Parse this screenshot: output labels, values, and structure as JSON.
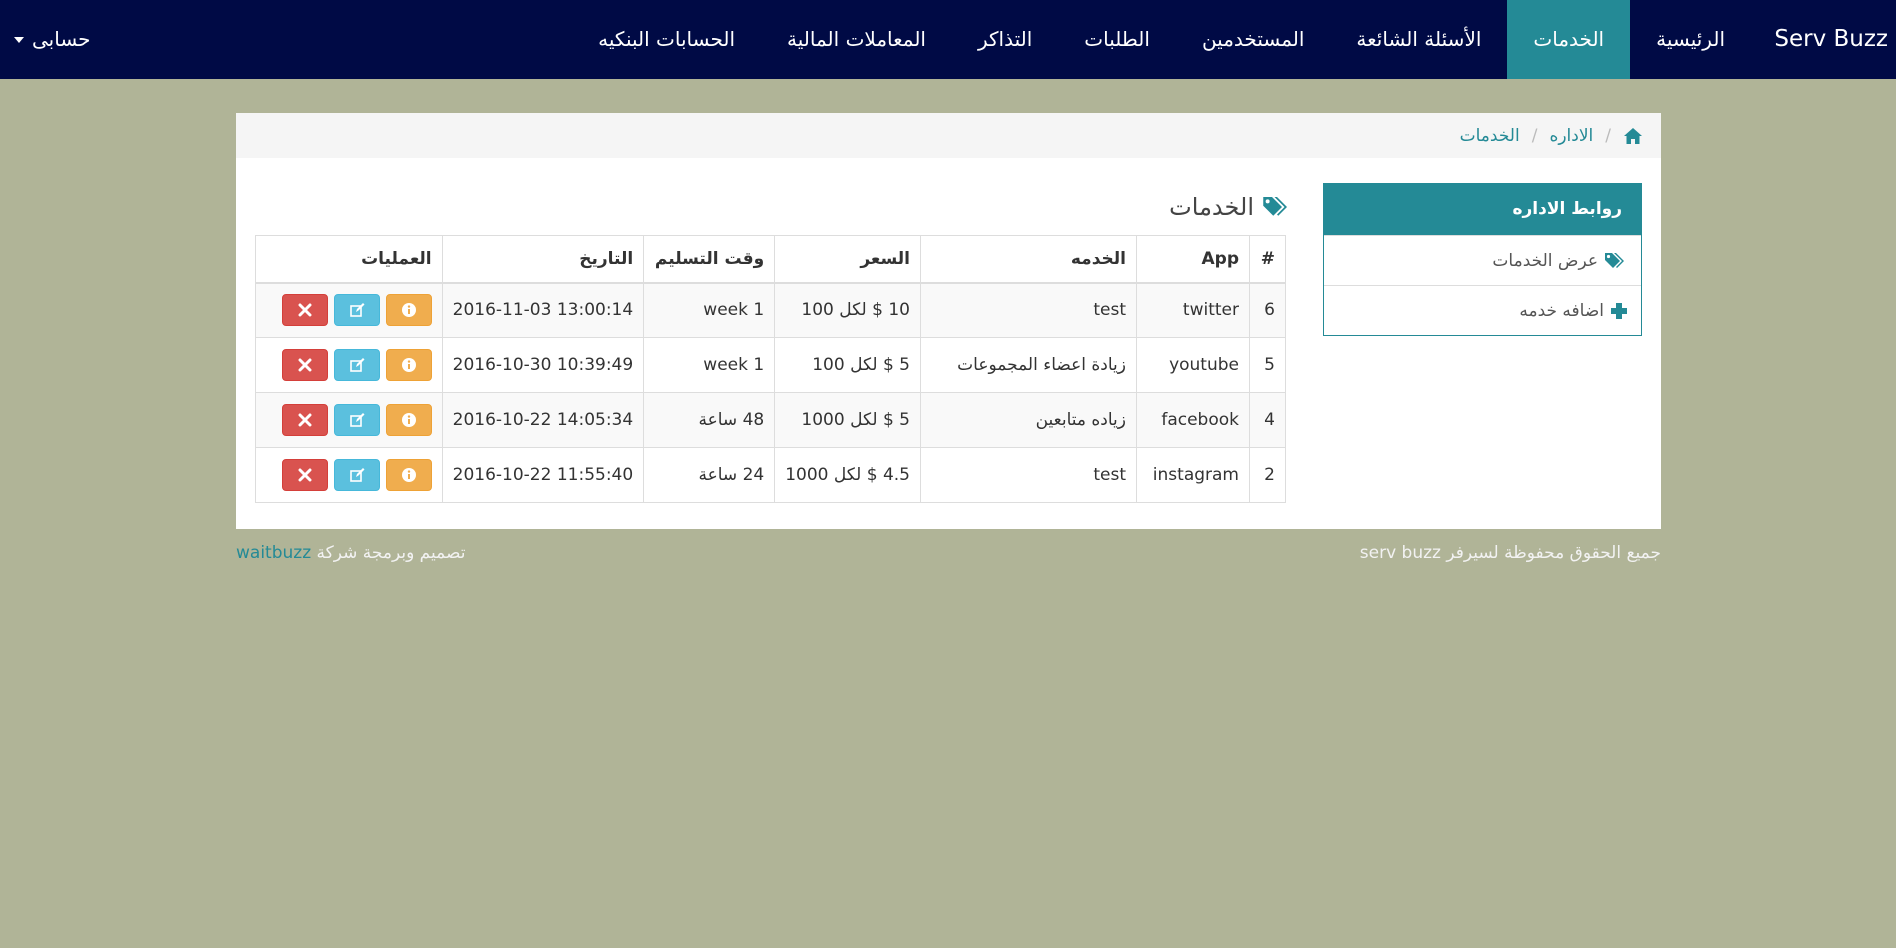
{
  "navbar": {
    "brand": "Serv Buzz",
    "items": [
      {
        "label": "الرئيسية"
      },
      {
        "label": "الخدمات"
      },
      {
        "label": "الأسئلة الشائعة"
      },
      {
        "label": "المستخدمين"
      },
      {
        "label": "الطلبات"
      },
      {
        "label": "التذاكر"
      },
      {
        "label": "المعاملات المالية"
      },
      {
        "label": "الحسابات البنكيه"
      }
    ],
    "active_index": 1,
    "account_label": "حسابى"
  },
  "breadcrumb": {
    "items": [
      "الاداره",
      "الخدمات"
    ],
    "separator": "/"
  },
  "sidebar": {
    "title": "روابط الاداره",
    "items": [
      {
        "label": "عرض الخدمات",
        "icon": "tags-icon"
      },
      {
        "label": "اضافه خدمه",
        "icon": "plus-icon"
      }
    ]
  },
  "main": {
    "title": "الخدمات",
    "table": {
      "headers": [
        "#",
        "App",
        "الخدمه",
        "السعر",
        "وقت التسليم",
        "التاريخ",
        "العمليات"
      ],
      "rows": [
        {
          "id": "6",
          "app": "twitter",
          "service": "test",
          "price": "10 $ لكل 100",
          "delivery": "1 week",
          "date": "2016-11-03 13:00:14"
        },
        {
          "id": "5",
          "app": "youtube",
          "service": "زيادة اعضاء المجموعات",
          "price": "5 $ لكل 100",
          "delivery": "1 week",
          "date": "2016-10-30 10:39:49"
        },
        {
          "id": "4",
          "app": "facebook",
          "service": "زياده متابعين",
          "price": "5 $ لكل 1000",
          "delivery": "48 ساعة",
          "date": "2016-10-22 14:05:34"
        },
        {
          "id": "2",
          "app": "instagram",
          "service": "test",
          "price": "4.5 $ لكل 1000",
          "delivery": "24 ساعة",
          "date": "2016-10-22 11:55:40"
        }
      ]
    }
  },
  "footer": {
    "copyright": "جميع الحقوق محفوظة لسيرفر serv buzz",
    "credit_prefix": "تصميم وبرمجة شركة",
    "credit_brand": "waitbuzz"
  },
  "colors": {
    "navbar_bg": "#000a45",
    "accent": "#248a96",
    "page_bg": "#b0b497",
    "info_btn": "#f0ad4e",
    "edit_btn": "#5bc0de",
    "delete_btn": "#d9534f"
  }
}
